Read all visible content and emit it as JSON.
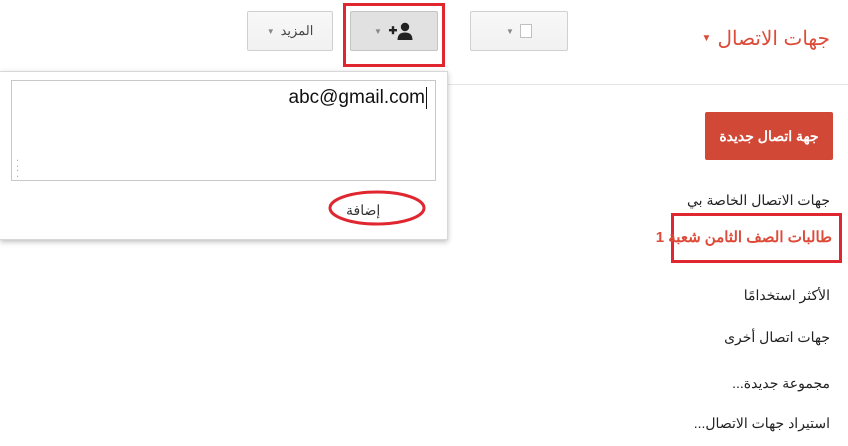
{
  "header": {
    "title": "جهات الاتصال",
    "title_caret": "▼"
  },
  "toolbar": {
    "add_caret": "▼",
    "checkbox_caret": "▼",
    "more_label": "المزيد",
    "more_caret": "▼"
  },
  "popup": {
    "email_value": "abc@gmail.com",
    "add_label": "إضافة"
  },
  "sidebar": {
    "new_contact": "جهة اتصال جديدة",
    "items": [
      "جهات الاتصال الخاصة بي",
      "طالبات الصف الثامن شعبة 1",
      "الأكثر استخدامًا",
      "جهات اتصال أخرى",
      "مجموعة جديدة...",
      "استيراد جهات الاتصال..."
    ]
  },
  "colors": {
    "accent_red": "#dd4b39",
    "highlight_red": "#e0262f",
    "button_red": "#d14836"
  }
}
